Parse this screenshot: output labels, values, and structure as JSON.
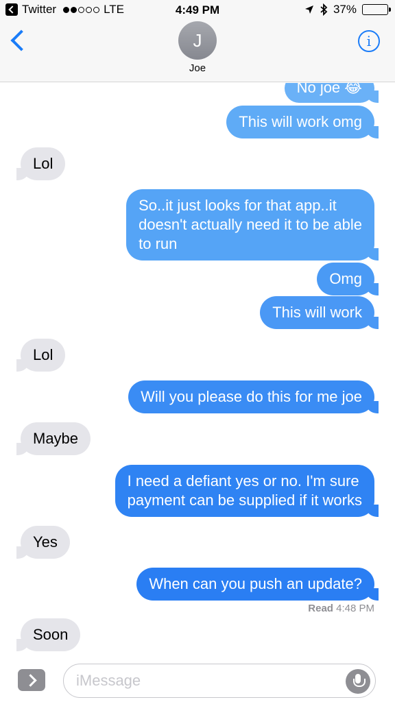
{
  "status_bar": {
    "back_app": "Twitter",
    "carrier": "LTE",
    "time": "4:49 PM",
    "battery_percent": "37%",
    "battery_level": 0.37
  },
  "header": {
    "avatar_initial": "J",
    "contact_name": "Joe"
  },
  "messages": [
    {
      "direction": "out",
      "text": "No joe 😂",
      "color": "#6ab1f7"
    },
    {
      "direction": "out",
      "text": "This will work omg",
      "color": "#5fabf6"
    },
    {
      "direction": "in",
      "text": "Lol"
    },
    {
      "direction": "out",
      "text": "So..it just looks for that app..it\ndoesn't actually need it to be able\nto run",
      "color": "#55a4f6"
    },
    {
      "direction": "out",
      "text": "Omg",
      "color": "#4a9af5"
    },
    {
      "direction": "out",
      "text": "This will work",
      "color": "#4a98f5"
    },
    {
      "direction": "in",
      "text": "Lol"
    },
    {
      "direction": "out",
      "text": "Will you please do this for me joe",
      "color": "#3a8cf4"
    },
    {
      "direction": "in",
      "text": "Maybe"
    },
    {
      "direction": "out",
      "text": "I need a defiant yes or no. I'm sure\npayment can be supplied if it works",
      "color": "#2f83f3"
    },
    {
      "direction": "in",
      "text": "Yes"
    },
    {
      "direction": "out",
      "text": "When can you push an update?",
      "color": "#2a7ef3"
    },
    {
      "direction": "in",
      "text": "Soon"
    }
  ],
  "read_receipt": {
    "label": "Read",
    "time": "4:48 PM"
  },
  "composer": {
    "placeholder": "iMessage"
  },
  "colors": {
    "accent": "#1a7cf8",
    "incoming_bubble": "#e5e5ea"
  }
}
